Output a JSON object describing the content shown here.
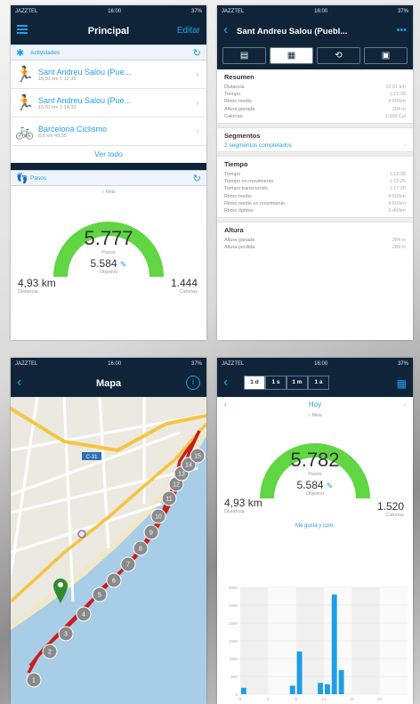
{
  "colors": {
    "accent": "#1f9ee8",
    "nav": "#0f2438",
    "gauge": "#5fd642",
    "route": "#c81e1e"
  },
  "status": {
    "carrier": "JAZZTEL",
    "time": "16:00",
    "battery": "37%"
  },
  "home": {
    "title": "Principal",
    "edit": "Editar",
    "activities_header": "Actividades",
    "activities": [
      {
        "title": "Sant Andreu Salou (Pue...",
        "meta": "15,01 km    1:12:39",
        "icon": "run-icon"
      },
      {
        "title": "Sant Andreu Salou (Pue...",
        "meta": "15,01 km    1:14:32",
        "icon": "run-icon"
      },
      {
        "title": "Barcelona Ciclismo",
        "meta": "8,8 km    49:35",
        "icon": "bike-icon"
      }
    ],
    "see_all": "Ver todo",
    "steps_header": "Pasos",
    "goal_marker": "Meta",
    "steps": "5.777",
    "steps_label": "Pasos",
    "goal": "5.584",
    "goal_label": "Objetivo",
    "goal_progress": 1.0,
    "distance": "4,93 km",
    "distance_label": "Distancia",
    "calories": "1.444",
    "calories_label": "Calorías"
  },
  "detail": {
    "title": "Sant Andreu Salou (Puebl...",
    "more": "•••",
    "summary_title": "Resumen",
    "summary": [
      {
        "k": "Distancia",
        "v": "15,01 km"
      },
      {
        "k": "Tiempo",
        "v": "1:12:39"
      },
      {
        "k": "Ritmo medio",
        "v": "4:50/km"
      },
      {
        "k": "Altura ganada",
        "v": "284 m"
      },
      {
        "k": "Calorías",
        "v": "1.109 Cal"
      }
    ],
    "segments_title": "Segmentos",
    "segments_link": "2 segmentos completados",
    "time_title": "Tiempo",
    "time": [
      {
        "k": "Tiempo",
        "v": "1:12:39"
      },
      {
        "k": "Tiempo en movimiento",
        "v": "1:12:25"
      },
      {
        "k": "Tiempo transcurrido",
        "v": "1:17:20"
      },
      {
        "k": "Ritmo medio",
        "v": "4:50/km"
      },
      {
        "k": "Ritmo medio en movimiento",
        "v": "4:50/km"
      },
      {
        "k": "Ritmo óptimo",
        "v": "3:40/km"
      }
    ],
    "altitude_title": "Altura",
    "altitude": [
      {
        "k": "Altura ganada",
        "v": "284 m"
      },
      {
        "k": "Altura perdida",
        "v": "289 m"
      }
    ]
  },
  "map": {
    "title": "Mapa",
    "info": "i",
    "road_label": "C-31",
    "markers": [
      "1",
      "2",
      "3",
      "4",
      "5",
      "6",
      "7",
      "8",
      "9",
      "10",
      "11",
      "12",
      "13",
      "14",
      "15"
    ]
  },
  "day": {
    "periods": [
      "1 d",
      "1 s",
      "1 m",
      "1 a"
    ],
    "date": "Hoy",
    "goal_marker": "Meta",
    "steps": "5.782",
    "steps_label": "Pasos",
    "goal": "5.584",
    "goal_label": "Objetivo",
    "goal_progress": 1.0,
    "distance": "4,93 km",
    "distance_label": "Distancia",
    "calories": "1.520",
    "calories_label": "Calorías",
    "like": "Me gusta y com."
  },
  "chart_data": {
    "type": "bar",
    "title": "",
    "xlabel": "",
    "ylabel": "",
    "x": [
      0.5,
      7.5,
      8.5,
      11.5,
      12.5,
      13.5,
      14.5
    ],
    "values": [
      180,
      240,
      1200,
      320,
      280,
      2800,
      680
    ],
    "ylim": [
      0,
      3000
    ],
    "xlim": [
      0,
      24
    ],
    "yticks": [
      "0",
      "500",
      "1000",
      "1500",
      "2000",
      "2500",
      "3000"
    ],
    "xticks": [
      "0",
      "4",
      "8",
      "12",
      "16",
      "20"
    ],
    "grid": true
  }
}
